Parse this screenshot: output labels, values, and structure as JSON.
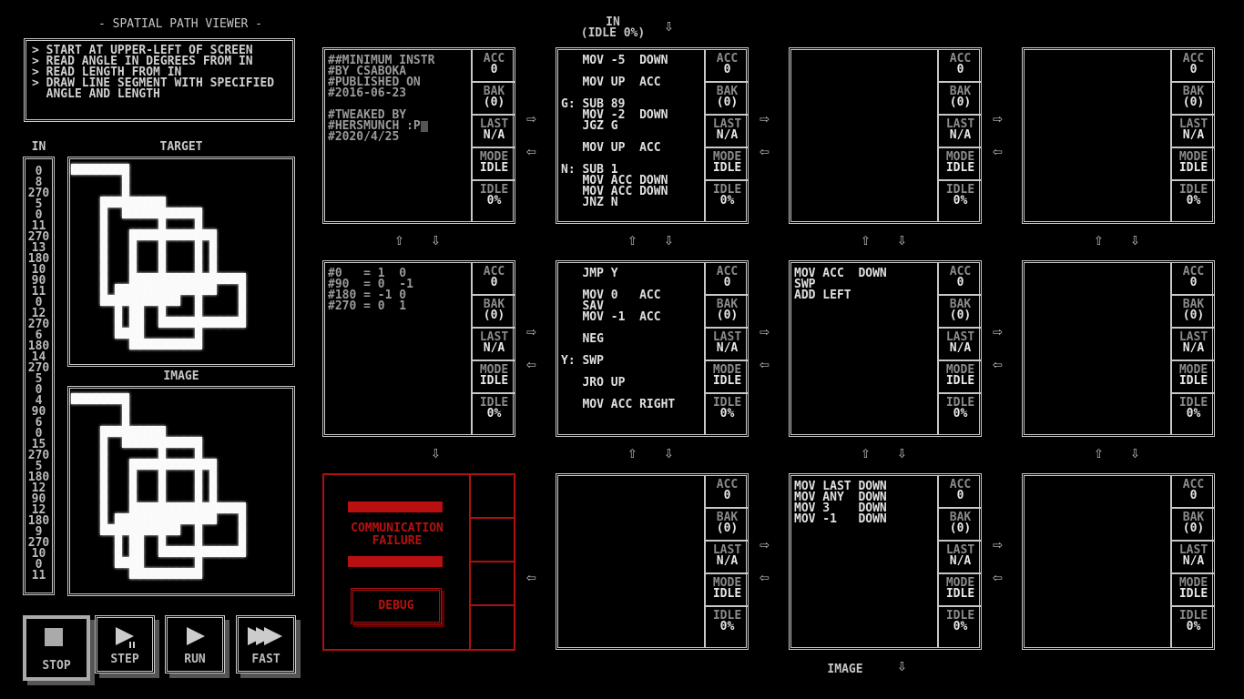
{
  "puzzle": {
    "title": "- SPATIAL PATH VIEWER -",
    "description": [
      "> START AT UPPER-LEFT OF SCREEN",
      "> READ ANGLE IN DEGREES FROM IN",
      "> READ LENGTH FROM IN",
      "> DRAW LINE SEGMENT WITH SPECIFIED",
      "  ANGLE AND LENGTH"
    ],
    "in_label": "IN",
    "target_label": "TARGET",
    "image_label": "IMAGE",
    "in_values": [
      "0",
      "8",
      "270",
      "5",
      "0",
      "11",
      "270",
      "13",
      "180",
      "10",
      "90",
      "11",
      "0",
      "12",
      "270",
      "6",
      "180",
      "14",
      "270",
      "5",
      "0",
      "4",
      "90",
      "6",
      "0",
      "15",
      "270",
      "5",
      "180",
      "12",
      "90",
      "12",
      "180",
      "9",
      "270",
      "10",
      "0",
      "11"
    ]
  },
  "controls": {
    "stop": "STOP",
    "step": "STEP",
    "run": "RUN",
    "fast": "FAST"
  },
  "ports": {
    "in_label": "IN",
    "in_status": "(IDLE 0%)",
    "out_label": "IMAGE"
  },
  "register_labels": [
    "ACC",
    "BAK",
    "LAST",
    "MODE",
    "IDLE"
  ],
  "failure": {
    "message_1": "COMMUNICATION",
    "message_2": "FAILURE",
    "debug": "DEBUG",
    "color": "#b01010"
  },
  "nodes": [
    {
      "type": "compute",
      "code": [
        "##MINIMUM INSTR",
        "#BY CSABOKA",
        "#PUBLISHED ON",
        "#2016-06-23",
        "",
        "#TWEAKED BY",
        "#HERSMUNCH :P",
        "#2020/4/25"
      ],
      "regs": [
        "0",
        "(0)",
        "N/A",
        "IDLE",
        "0%"
      ]
    },
    {
      "type": "compute",
      "code": [
        "   MOV -5  DOWN",
        "",
        "   MOV UP  ACC",
        "",
        "G: SUB 89",
        "   MOV -2  DOWN",
        "   JGZ G",
        "",
        "   MOV UP  ACC",
        "",
        "N: SUB 1",
        "   MOV ACC DOWN",
        "   MOV ACC DOWN",
        "   JNZ N"
      ],
      "regs": [
        "0",
        "(0)",
        "N/A",
        "IDLE",
        "0%"
      ]
    },
    {
      "type": "compute",
      "code": [],
      "regs": [
        "0",
        "(0)",
        "N/A",
        "IDLE",
        "0%"
      ]
    },
    {
      "type": "compute",
      "code": [],
      "regs": [
        "0",
        "(0)",
        "N/A",
        "IDLE",
        "0%"
      ]
    },
    {
      "type": "compute",
      "code": [
        "#0   = 1  0",
        "#90  = 0  -1",
        "#180 = -1 0",
        "#270 = 0  1"
      ],
      "regs": [
        "0",
        "(0)",
        "N/A",
        "IDLE",
        "0%"
      ]
    },
    {
      "type": "compute",
      "code": [
        "   JMP Y",
        "",
        "   MOV 0   ACC",
        "   SAV",
        "   MOV -1  ACC",
        "",
        "   NEG",
        "",
        "Y: SWP",
        "",
        "   JRO UP",
        "",
        "   MOV ACC RIGHT"
      ],
      "regs": [
        "0",
        "(0)",
        "N/A",
        "IDLE",
        "0%"
      ]
    },
    {
      "type": "compute",
      "code": [
        "MOV ACC  DOWN",
        "SWP",
        "ADD LEFT"
      ],
      "regs": [
        "0",
        "(0)",
        "N/A",
        "IDLE",
        "0%"
      ]
    },
    {
      "type": "compute",
      "code": [],
      "regs": [
        "0",
        "(0)",
        "N/A",
        "IDLE",
        "0%"
      ]
    },
    {
      "type": "failure"
    },
    {
      "type": "compute",
      "code": [],
      "regs": [
        "0",
        "(0)",
        "N/A",
        "IDLE",
        "0%"
      ]
    },
    {
      "type": "compute",
      "code": [
        "MOV LAST DOWN",
        "MOV ANY  DOWN",
        "MOV 3    DOWN",
        "MOV -1   DOWN"
      ],
      "regs": [
        "0",
        "(0)",
        "N/A",
        "IDLE",
        "0%"
      ]
    },
    {
      "type": "compute",
      "code": [],
      "regs": [
        "0",
        "(0)",
        "N/A",
        "IDLE",
        "0%"
      ]
    }
  ]
}
